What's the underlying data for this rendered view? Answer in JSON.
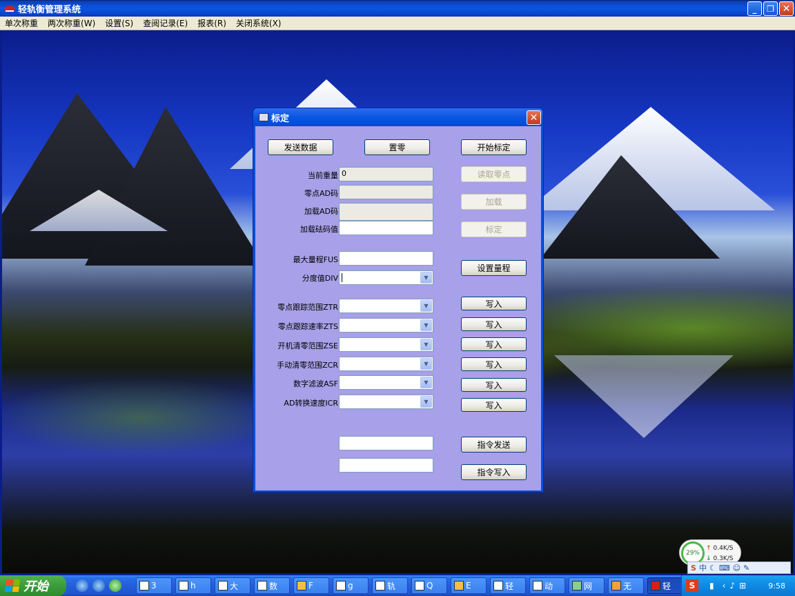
{
  "window": {
    "title": "轻轨衡管理系统"
  },
  "menu": [
    "单次称重",
    "两次称重(W)",
    "设置(S)",
    "查阅记录(E)",
    "报表(R)",
    "关闭系统(X)"
  ],
  "dialog": {
    "title": "标定",
    "buttons": {
      "send_data": "发送数据",
      "zero": "置零",
      "start_calibration": "开始标定",
      "read_zero": "读取零点",
      "load": "加载",
      "calibrate": "标定",
      "set_range": "设置量程",
      "write": "写入",
      "cmd_send": "指令发送",
      "cmd_write": "指令写入"
    },
    "fields": {
      "current_weight": {
        "label": "当前重量",
        "value": "0"
      },
      "zero_ad": {
        "label": "零点AD码",
        "value": ""
      },
      "load_ad": {
        "label": "加载AD码",
        "value": ""
      },
      "load_weight": {
        "label": "加载砝码值",
        "value": ""
      },
      "max_range": {
        "label": "最大量程FUS",
        "value": ""
      },
      "division": {
        "label": "分度值DIV",
        "value": ""
      },
      "ztr": {
        "label": "零点跟踪范围ZTR",
        "value": ""
      },
      "zts": {
        "label": "零点跟踪速率ZTS",
        "value": ""
      },
      "zse": {
        "label": "开机清零范围ZSE",
        "value": ""
      },
      "zcr": {
        "label": "手动清零范围ZCR",
        "value": ""
      },
      "asf": {
        "label": "数字滤波ASF",
        "value": ""
      },
      "icr": {
        "label": "AD转换速度ICR",
        "value": ""
      },
      "cmd1": {
        "value": ""
      },
      "cmd2": {
        "value": ""
      }
    }
  },
  "taskbar": {
    "start": "开始",
    "items": [
      "3",
      "h",
      "大",
      "数",
      "F",
      "g",
      "轨",
      "Q",
      "E",
      "轻",
      "动",
      "网",
      "无",
      "轻"
    ],
    "clock": "9:58"
  },
  "netwidget": {
    "cpu": "29%",
    "up": "0.4K/S",
    "down": "0.3K/S"
  },
  "ime": {
    "label": "中"
  },
  "colors": {
    "titlebar": "#0a56e0",
    "dialog_body": "#a8a0e8",
    "close": "#c13a18"
  }
}
